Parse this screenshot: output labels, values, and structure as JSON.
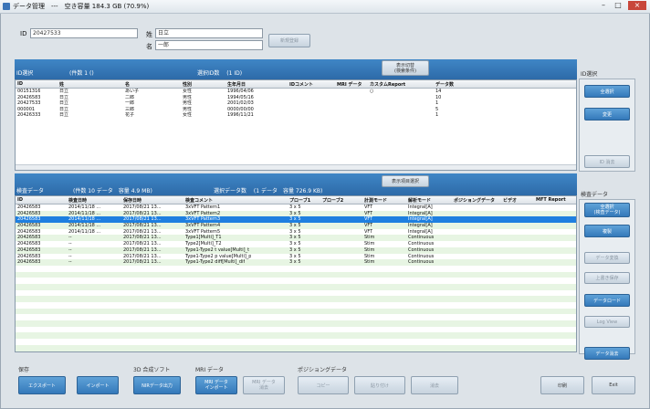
{
  "window": {
    "title": "データ管理　---　空き容量 184.3 GB (70.9%)"
  },
  "patient": {
    "id_label": "ID",
    "id_value": "20427533",
    "surname_label": "姓",
    "surname_value": "日立",
    "name_label": "名",
    "name_value": "一郎",
    "register_button": "新規登録"
  },
  "id_section": {
    "title": "ID選択",
    "count": "(件数 1 ()",
    "selected": "選択ID数　 (1 ID)",
    "toggle_button": "表示切替\n(検索条件)",
    "columns": [
      "ID",
      "姓",
      "名",
      "性別",
      "生年月日",
      "IDコメント",
      "MRI データ",
      "カスタムReport",
      "データ数"
    ],
    "rows": [
      [
        "00151316",
        "日立",
        "あい子",
        "女性",
        "1996/04/06",
        "",
        "",
        "○",
        "14"
      ],
      [
        "20426583",
        "日立",
        "二郎",
        "男性",
        "1994/05/16",
        "",
        "",
        "",
        "10"
      ],
      [
        "20427533",
        "日立",
        "一郎",
        "男性",
        "2001/02/03",
        "",
        "",
        "",
        "1"
      ],
      [
        "000001",
        "日立",
        "三郎",
        "男性",
        "0000/00/00",
        "",
        "",
        "",
        "5"
      ],
      [
        "20426333",
        "日立",
        "花子",
        "女性",
        "1996/11/21",
        "",
        "",
        "",
        "1"
      ]
    ]
  },
  "side_id": {
    "title": "ID選択",
    "select_all": "全選択",
    "change": "変更",
    "delete": "ID 消去"
  },
  "data_section": {
    "title": "検査データ",
    "count": "(件数 10 データ　容量 4.9 MB)",
    "selected": "選択データ数　 (1 データ　容量 726.9 KB)",
    "toggle_button": "表示項目選択",
    "columns": [
      "ID",
      "検査日時",
      "保存日時",
      "検査コメント",
      "プローブ1",
      "プローブ2",
      "計測モード",
      "解析モード",
      "ポジショングデータ",
      "ビデオ",
      "MFT Report"
    ],
    "rows": [
      [
        "20426583",
        "2014/11/18 ...",
        "2017/08/21 13...",
        "3xVFT Pattern1",
        "3 x 5",
        "",
        "VFT",
        "Integral[A]",
        "",
        "",
        ""
      ],
      [
        "20426583",
        "2014/11/18 ...",
        "2017/08/21 13...",
        "3xVFT Pattern2",
        "3 x 5",
        "",
        "VFT",
        "Integral[A]",
        "",
        "",
        ""
      ],
      [
        "20426583",
        "2014/11/18 ...",
        "2017/08/21 13...",
        "3xVFT Pattern3",
        "3 x 5",
        "",
        "VFT",
        "Integral[A]",
        "",
        "",
        ""
      ],
      [
        "20426583",
        "2014/11/18 ...",
        "2017/08/21 13...",
        "3xVFT Pattern4",
        "3 x 5",
        "",
        "VFT",
        "Integral[A]",
        "",
        "",
        ""
      ],
      [
        "20426583",
        "2014/11/18 ...",
        "2017/08/21 13...",
        "3xVFT Pattern5",
        "3 x 5",
        "",
        "VFT",
        "Integral[A]",
        "",
        "",
        ""
      ],
      [
        "20426583",
        "--",
        "2017/08/21 13...",
        "Type1[Multi]_T1",
        "3 x 5",
        "",
        "Stim",
        "Continuous",
        "",
        "",
        ""
      ],
      [
        "20426583",
        "--",
        "2017/08/21 13...",
        "Type2[Multi]_T2",
        "3 x 5",
        "",
        "Stim",
        "Continuous",
        "",
        "",
        ""
      ],
      [
        "20426583",
        "--",
        "2017/08/21 13...",
        "Type1-Type2 t value[Multi]_t",
        "3 x 5",
        "",
        "Stim",
        "Continuous",
        "",
        "",
        ""
      ],
      [
        "20426583",
        "--",
        "2017/08/21 13...",
        "Type1-Type2 p value[Multi]_p",
        "3 x 5",
        "",
        "Stim",
        "Continuous",
        "",
        "",
        ""
      ],
      [
        "20426583",
        "--",
        "2017/08/21 13...",
        "Type1-Type2 diff[Multi]_dif",
        "3 x 5",
        "",
        "Stim",
        "Continuous",
        "",
        "",
        ""
      ]
    ],
    "selected_row_index": 2
  },
  "side_data": {
    "title": "検査データ",
    "select_all": "全選択\n(検査データ)",
    "copy": "複製",
    "data_conversion": "データ変換",
    "report": "上書き保存",
    "data_load": "データロード",
    "log_view": "Log View",
    "data_delete": "データ消去"
  },
  "bottom": {
    "save_group": "保存",
    "export": "エクスポート",
    "import": "インポート",
    "analysis_group": "3D 合成ソフト",
    "nirs_output": "NIRデータ出力",
    "mri_group": "MRI データ",
    "mri_import": "MRI データ\nインポート",
    "mri_delete": "MRI データ\n消去",
    "position_group": "ポジショングデータ",
    "copy": "コピー",
    "paste": "貼り付け",
    "erase": "消去",
    "print": "印刷",
    "exit": "Exit"
  },
  "colors": {
    "accent": "#2f6fad",
    "selected_row": "#1e7fe0",
    "even_row": "#e7f5e3"
  }
}
